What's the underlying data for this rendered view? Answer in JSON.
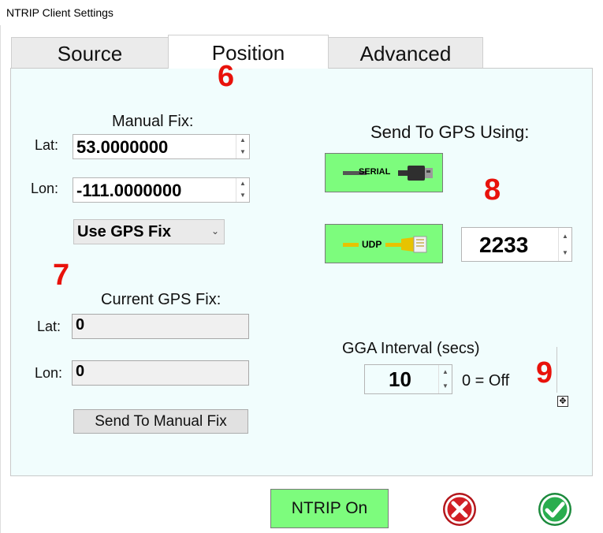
{
  "window": {
    "title": "NTRIP Client Settings"
  },
  "tabs": [
    {
      "label": "Source",
      "active": false
    },
    {
      "label": "Position",
      "active": true
    },
    {
      "label": "Advanced",
      "active": false
    }
  ],
  "annotations": {
    "n6": "6",
    "n7": "7",
    "n8": "8",
    "n9": "9"
  },
  "manual_fix": {
    "heading": "Manual Fix:",
    "lat_label": "Lat:",
    "lat_value": "53.0000000",
    "lon_label": "Lon:",
    "lon_value": "-111.0000000",
    "mode_value": "Use GPS Fix"
  },
  "current_fix": {
    "heading": "Current GPS Fix:",
    "lat_label": "Lat:",
    "lat_value": "0",
    "lon_label": "Lon:",
    "lon_value": "0",
    "send_button": "Send To Manual Fix"
  },
  "send_to_gps": {
    "heading": "Send To GPS Using:",
    "serial_label": "SERIAL",
    "udp_label": "UDP",
    "udp_port": "2233"
  },
  "gga": {
    "heading": "GGA Interval (secs)",
    "value": "10",
    "note": "0 = Off"
  },
  "footer": {
    "ntrip_button": "NTRIP On"
  },
  "colors": {
    "panel_bg": "#f1fdfd",
    "green": "#7dfc7d",
    "annotation_red": "#e8120b"
  }
}
